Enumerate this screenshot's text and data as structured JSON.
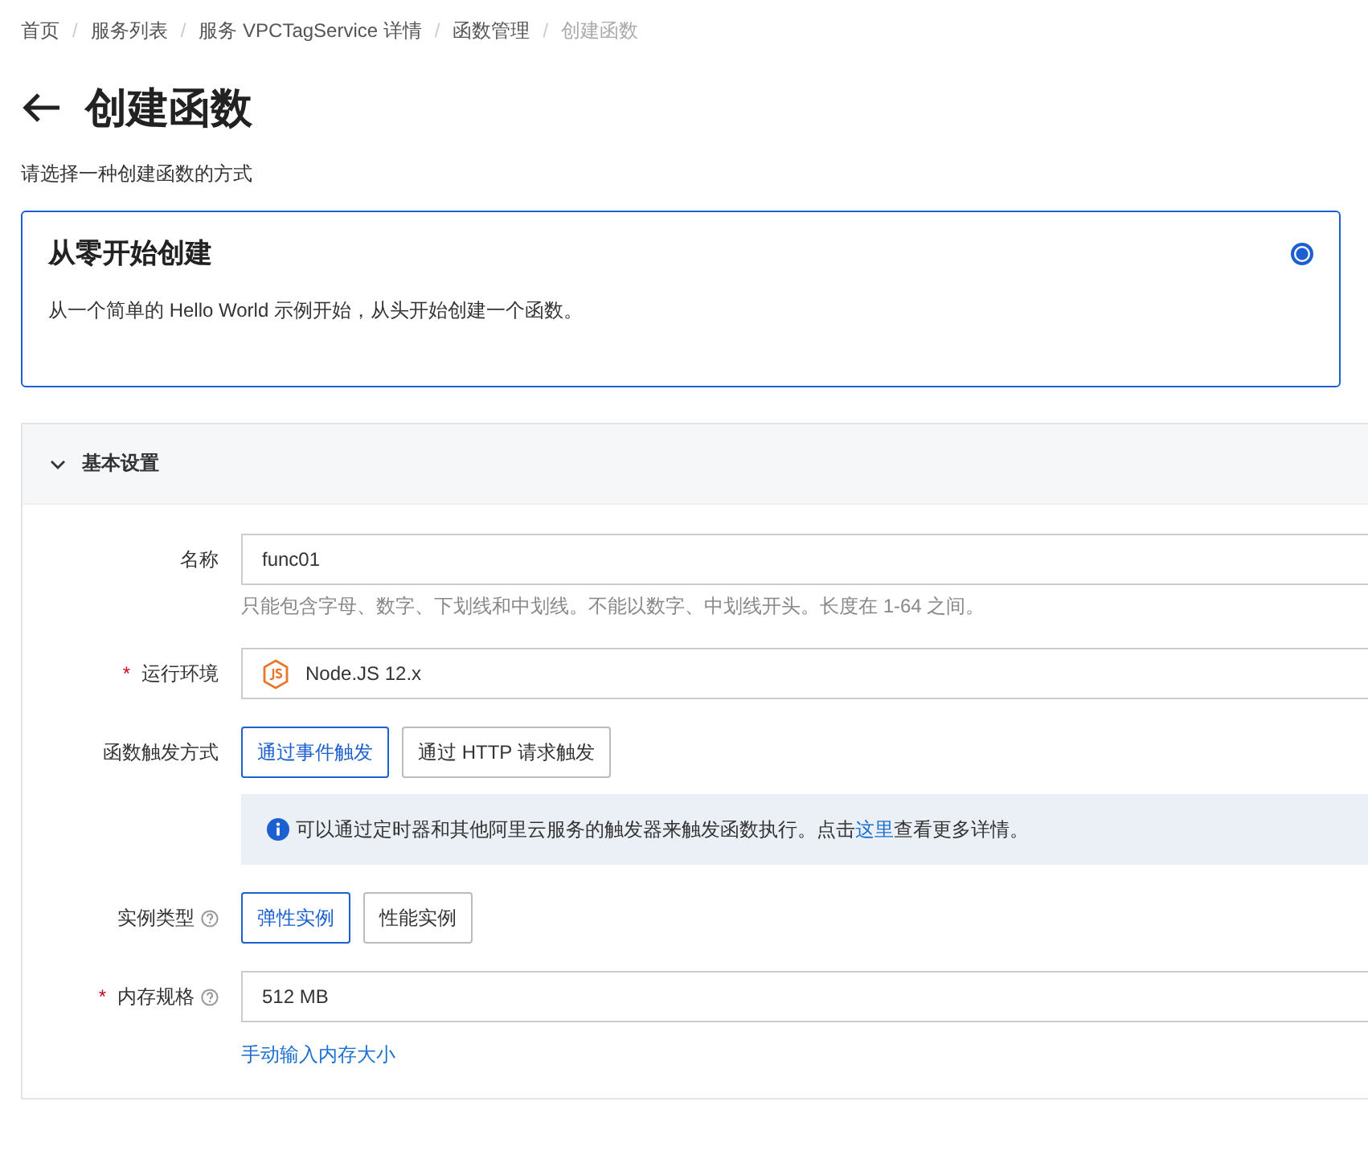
{
  "breadcrumb": [
    {
      "label": "首页",
      "current": false
    },
    {
      "separator": "/",
      "label": "服务列表",
      "current": false
    },
    {
      "separator": "/",
      "label": "服务 VPCTagService 详情",
      "current": false
    },
    {
      "separator": "/",
      "label": "函数管理",
      "current": false
    },
    {
      "separator": "/",
      "label": "创建函数",
      "current": true
    }
  ],
  "title": "创建函数",
  "subtitle": "请选择一种创建函数的方式",
  "option_card": {
    "title": "从零开始创建",
    "description": "从一个简单的 Hello World 示例开始，从头开始创建一个函数。",
    "selected": true
  },
  "section": {
    "title": "基本设置",
    "expanded": true,
    "fields": [
      {
        "kind": "input",
        "label": "名称",
        "help": false,
        "value": "func01",
        "hint": "只能包含字母、数字、下划线和中划线。不能以数字、中划线开头。长度在 1-64 之间。"
      },
      {
        "kind": "runtime",
        "required_mark": "*",
        "label": "运行环境",
        "help": false,
        "value": "Node.JS 12.x"
      },
      {
        "kind": "choices",
        "label": "函数触发方式",
        "help": false,
        "options": [
          {
            "label": "通过事件触发",
            "selected": true
          },
          {
            "label": "通过 HTTP 请求触发",
            "selected": false
          }
        ],
        "notice": {
          "text": "可以通过定时器和其他阿里云服务的触发器来触发函数执行。点击",
          "link": "这里",
          "after": "查看更多详情。"
        }
      },
      {
        "kind": "choices",
        "label": "实例类型",
        "help": true,
        "options": [
          {
            "label": "弹性实例",
            "selected": true
          },
          {
            "label": "性能实例",
            "selected": false
          }
        ]
      },
      {
        "kind": "input",
        "required_mark": "*",
        "label": "内存规格",
        "help": true,
        "value": "512 MB",
        "link": "手动输入内存大小"
      }
    ]
  }
}
